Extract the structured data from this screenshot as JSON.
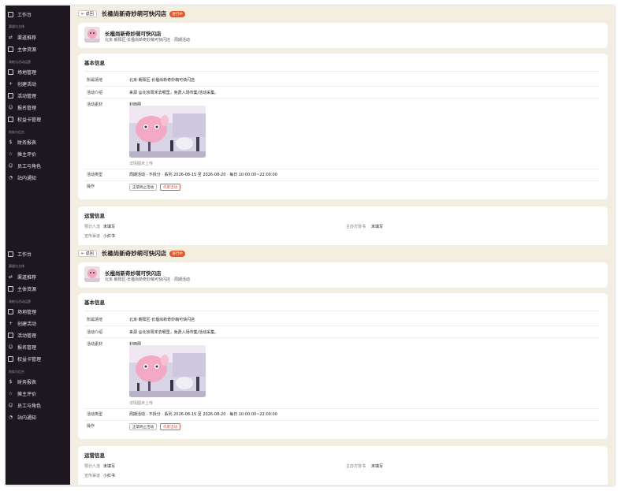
{
  "sidebar": {
    "workbench": "工作台",
    "group1": "渠道与主体",
    "channel_rec": "渠道推荐",
    "subject_res": "主体资源",
    "group2": "场地与活动运营",
    "venue_mgmt": "场地管理",
    "create_event": "创建活动",
    "event_mgmt": "活动管理",
    "signup_mgmt": "报名管理",
    "benefit_mgmt": "权益卡管理",
    "group3": "财务与后台",
    "finance": "财务报表",
    "stall_review": "摊主评价",
    "staff_roles": "员工与角色",
    "site_notice": "站内通知"
  },
  "header": {
    "back": "← 返回",
    "title": "长楹尚新奇妙萌可快闪店",
    "status": "进行中",
    "status_color": "#e05a2b"
  },
  "shop": {
    "name": "长楹尚新奇妙萌可快闪店",
    "sub": "北京·朝阳区·长楹尚新奇妙萌可快闪店 · 周期活动"
  },
  "basic": {
    "title": "基本信息",
    "venue_label": "所属场地",
    "venue_value": "北京·朝阳区·长楹尚新奇妙萌可快闪店",
    "intro_label": "活动介绍",
    "intro_value": "来源 @北京周末去哪里。免费入场市集/活动采集。",
    "material_label": "活动素材",
    "cover_label": "封面图",
    "cover_note": "详情图未上传",
    "type_label": "活动类型",
    "type_value": "周期活动 · 不拆分 · 系列 2026-08-15 至 2026-08-20 · 每日 10:00:00~22:00:00",
    "ops_label": "操作",
    "btn_stop": "正常终止活动",
    "btn_cancel": "作废活动"
  },
  "ops": {
    "title": "运营信息",
    "est_people_label": "预计人流",
    "est_people_value": "未填写",
    "organizer_label": "主办方背书",
    "organizer_value": "未填写",
    "channel_label": "宣传渠道",
    "channel_value": "小红书"
  }
}
